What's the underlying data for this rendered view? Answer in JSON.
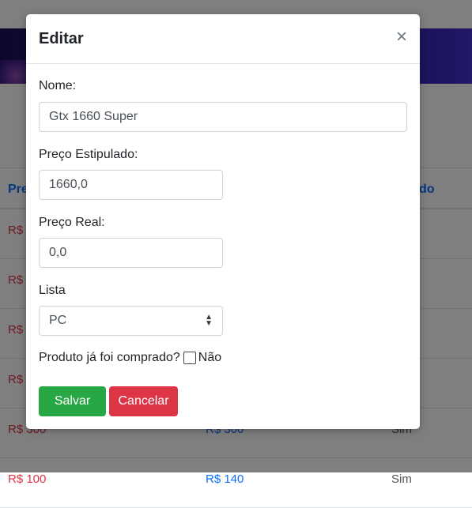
{
  "background": {
    "table_header": {
      "col_a": "Pre",
      "col_b": "do"
    },
    "rows": [
      {
        "a": "R$",
        "b": "",
        "c": ""
      },
      {
        "a": "R$",
        "b": "",
        "c": ""
      },
      {
        "a": "R$",
        "b": "",
        "c": ""
      },
      {
        "a": "R$",
        "b": "",
        "c": ""
      },
      {
        "a": "R$ 300",
        "b": "R$ 300",
        "c": "Sim"
      },
      {
        "a": "R$ 100",
        "b": "R$ 140",
        "c": "Sim"
      }
    ]
  },
  "modal": {
    "title": "Editar",
    "close_glyph": "×",
    "name_label": "Nome:",
    "name_value": "Gtx 1660 Super",
    "price_est_label": "Preço Estipulado:",
    "price_est_value": "1660,0",
    "price_real_label": "Preço Real:",
    "price_real_value": "0,0",
    "list_label": "Lista",
    "list_selected": "PC",
    "bought_label": "Produto já foi comprado?",
    "bought_state_text": "Não",
    "bought_checked": false,
    "save_label": "Salvar",
    "cancel_label": "Cancelar"
  },
  "colors": {
    "save": "#28a745",
    "cancel": "#dc3545",
    "link": "#0d6efd"
  }
}
